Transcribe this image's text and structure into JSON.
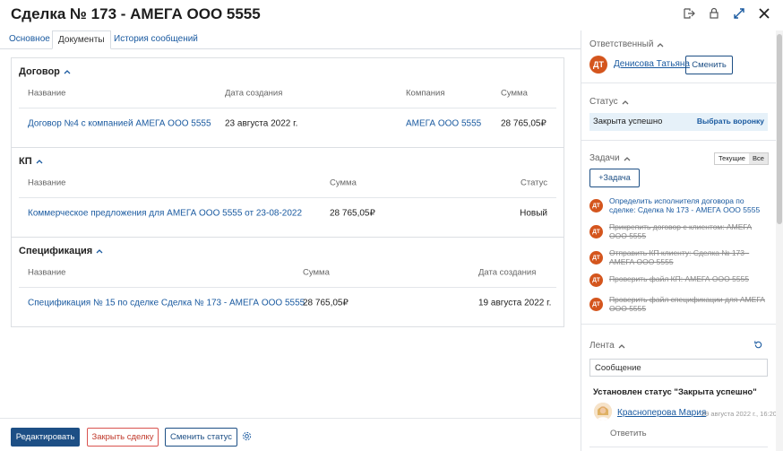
{
  "header": {
    "title": "Сделка № 173 - АМЕГА ООО 5555",
    "icons": [
      "export-icon",
      "lock-icon",
      "expand-icon",
      "close-icon"
    ]
  },
  "tabs": [
    {
      "label": "Основное",
      "active": false
    },
    {
      "label": "Документы",
      "active": true
    },
    {
      "label": "История сообщений",
      "active": false
    }
  ],
  "contracts": {
    "title": "Договор",
    "columns": [
      "Название",
      "Дата создания",
      "Компания",
      "Сумма"
    ],
    "rows": [
      {
        "name": "Договор №4 с компанией АМЕГА ООО 5555",
        "date": "23 августа 2022 г.",
        "company": "АМЕГА ООО 5555",
        "sum": "28 765,05₽"
      }
    ]
  },
  "kp": {
    "title": "КП",
    "columns": [
      "Название",
      "Сумма",
      "Статус"
    ],
    "rows": [
      {
        "name": "Коммерческое предложения для АМЕГА ООО 5555 от 23-08-2022",
        "sum": "28 765,05₽",
        "status": "Новый"
      }
    ]
  },
  "spec": {
    "title": "Спецификация",
    "columns": [
      "Название",
      "Сумма",
      "Дата создания"
    ],
    "rows": [
      {
        "name": "Спецификация № 15 по сделке Сделка № 173 - АМЕГА ООО 5555",
        "sum": "28 765,05₽",
        "date": "19 августа 2022 г."
      }
    ]
  },
  "footer": {
    "edit": "Редактировать",
    "close_deal": "Закрыть сделку",
    "change_status": "Сменить статус"
  },
  "sidebar": {
    "responsible": {
      "label": "Ответственный",
      "initials": "ДТ",
      "name": "Денисова Татьяна",
      "change": "Сменить"
    },
    "status": {
      "label": "Статус",
      "value": "Закрыта успешно",
      "funnel": "Выбрать воронку"
    },
    "tasks": {
      "label": "Задачи",
      "filter_current": "Текущие",
      "filter_all": "Все",
      "add": "+Задача",
      "items": [
        {
          "initials": "ДТ",
          "text": "Определить исполнителя договора по сделке: Сделка № 173 - АМЕГА ООО 5555",
          "done": false
        },
        {
          "initials": "ДТ",
          "text": "Прикрепить договор с клиентом: АМЕГА ООО 5555",
          "done": true
        },
        {
          "initials": "ДТ",
          "text": "Отправить КП клиенту: Сделка № 173 - АМЕГА ООО 5555",
          "done": true
        },
        {
          "initials": "ДТ",
          "text": "Проверить файл КП: АМЕГА ООО 5555",
          "done": true
        },
        {
          "initials": "ДТ",
          "text": "Проверить файл спецификации для АМЕГА ООО 5555",
          "done": true
        }
      ]
    },
    "feed": {
      "label": "Лента",
      "input_value": "Сообщение",
      "event": "Установлен статус \"Закрыта успешно\"",
      "author": "Красноперова Мария",
      "time": "29 августа 2022 г., 16:20",
      "reply": "Ответить"
    }
  },
  "colors": {
    "accent": "#1d4f85",
    "link": "#1a5aa0",
    "avatar": "#d4551d",
    "danger": "#d9534f",
    "status_bg": "#e6f1f9"
  }
}
